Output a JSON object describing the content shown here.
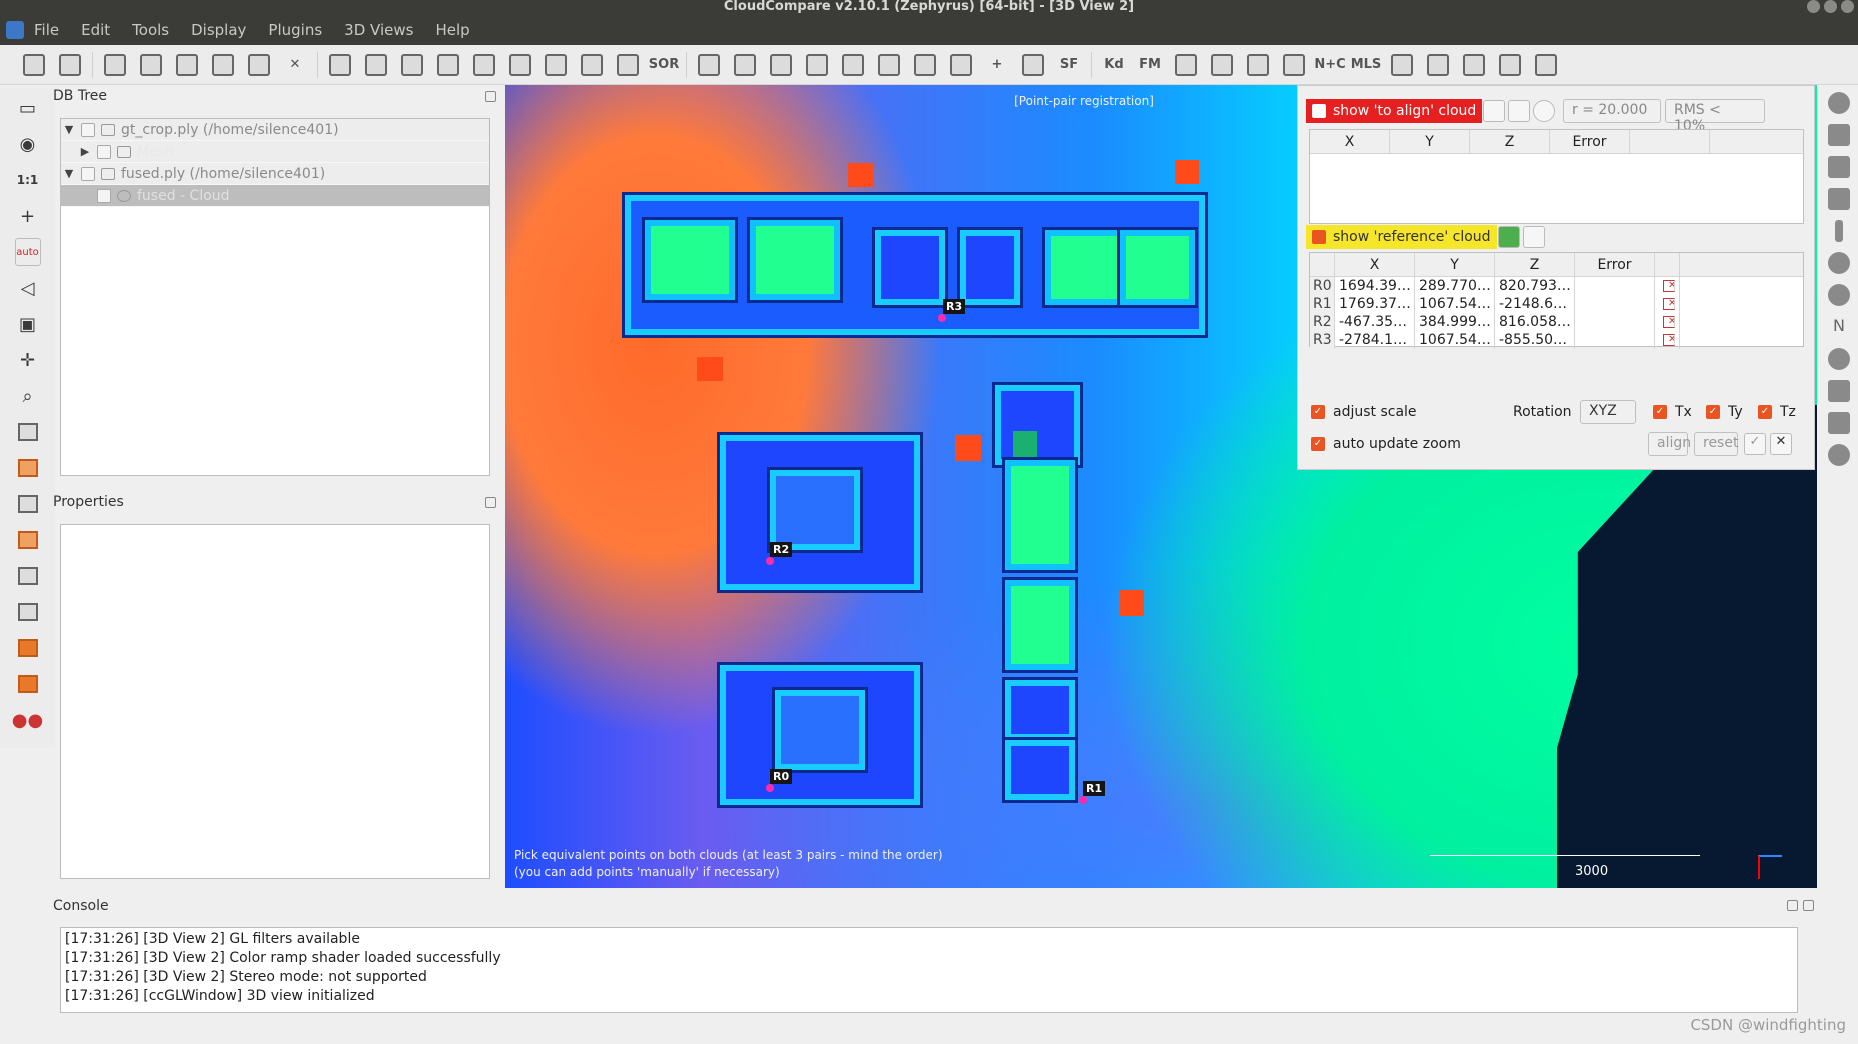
{
  "window": {
    "title": "CloudCompare v2.10.1 (Zephyrus) [64-bit] - [3D View 2]"
  },
  "menu": [
    "File",
    "Edit",
    "Tools",
    "Display",
    "Plugins",
    "3D Views",
    "Help"
  ],
  "toolbar": {
    "labels": [
      "SOR",
      "SF",
      "Kd",
      "FM",
      "N+C",
      "MLS"
    ]
  },
  "lefttools": {
    "zoom_label": "1:1",
    "auto_label": "auto"
  },
  "dbtree": {
    "title": "DB Tree",
    "items": [
      {
        "label": "gt_crop.ply (/home/silence401)"
      },
      {
        "label": "Mesh"
      },
      {
        "label": "fused.ply (/home/silence401)"
      },
      {
        "label": "fused - Cloud"
      }
    ]
  },
  "properties": {
    "title": "Properties"
  },
  "view": {
    "caption": "[Point-pair registration]",
    "hint_line1": "Pick equivalent points on both clouds (at least 3 pairs - mind the order)",
    "hint_line2": "(you can add points 'manually' if necessary)",
    "scale_label": "3000",
    "markers": [
      "R0",
      "R1",
      "R2",
      "R3"
    ]
  },
  "registration": {
    "to_align_label": "show 'to align' cloud",
    "radius_value": "r = 20.000",
    "rms_value": "RMS < 10%",
    "align_headers": [
      "X",
      "Y",
      "Z",
      "Error"
    ],
    "reference_label": "show 'reference' cloud",
    "ref_headers": [
      "X",
      "Y",
      "Z",
      "Error"
    ],
    "rows": [
      {
        "id": "R0",
        "x": "1694.39…",
        "y": "289.770…",
        "z": "820.793…",
        "err": ""
      },
      {
        "id": "R1",
        "x": "1769.37…",
        "y": "1067.54…",
        "z": "-2148.6…",
        "err": ""
      },
      {
        "id": "R2",
        "x": "-467.35…",
        "y": "384.999…",
        "z": "816.058…",
        "err": ""
      },
      {
        "id": "R3",
        "x": "-2784.1…",
        "y": "1067.54…",
        "z": "-855.50…",
        "err": ""
      }
    ],
    "adjust_scale": "adjust scale",
    "rotation_label": "Rotation",
    "rotation_value": "XYZ",
    "tx": "Tx",
    "ty": "Ty",
    "tz": "Tz",
    "auto_update_zoom": "auto update zoom",
    "align_button": "align",
    "reset_button": "reset"
  },
  "console": {
    "title": "Console",
    "lines": [
      "[17:31:26] [3D View 2] GL filters available",
      "[17:31:26] [3D View 2] Color ramp shader loaded successfully",
      "[17:31:26] [3D View 2] Stereo mode: not supported",
      "[17:31:26] [ccGLWindow] 3D view initialized"
    ]
  },
  "watermark": "CSDN @windfighting",
  "colors": {
    "accent": "#e95420",
    "titlebar": "#3b3b38",
    "red_toggle": "#e62020",
    "yellow_toggle": "#f5e62a"
  }
}
